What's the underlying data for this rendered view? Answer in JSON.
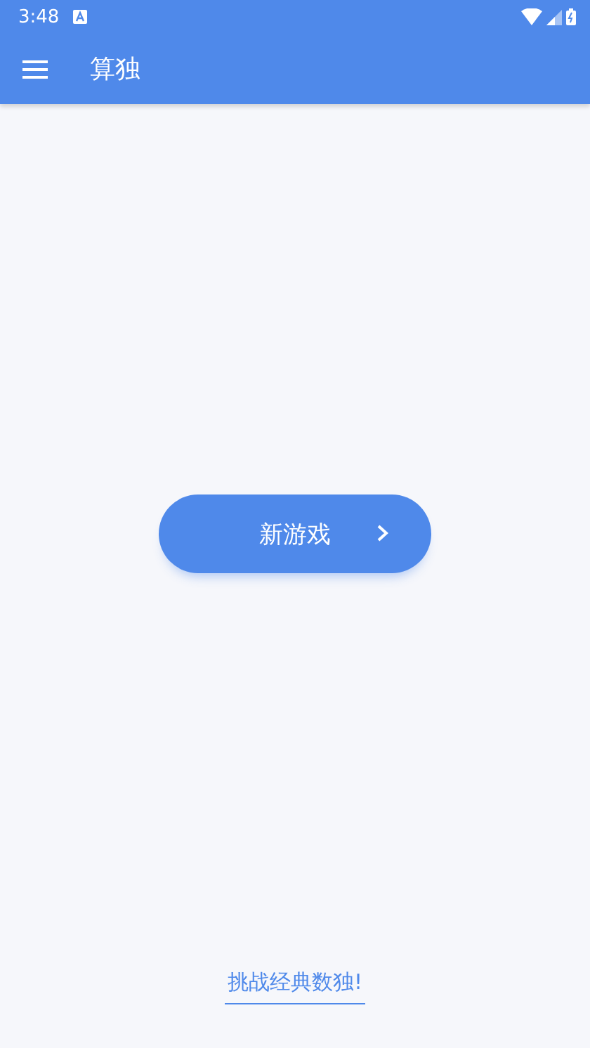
{
  "status_bar": {
    "time": "3:48"
  },
  "app_bar": {
    "title": "算独"
  },
  "new_game_button": {
    "label": "新游戏"
  },
  "challenge_link": {
    "label": "挑战经典数独!"
  }
}
